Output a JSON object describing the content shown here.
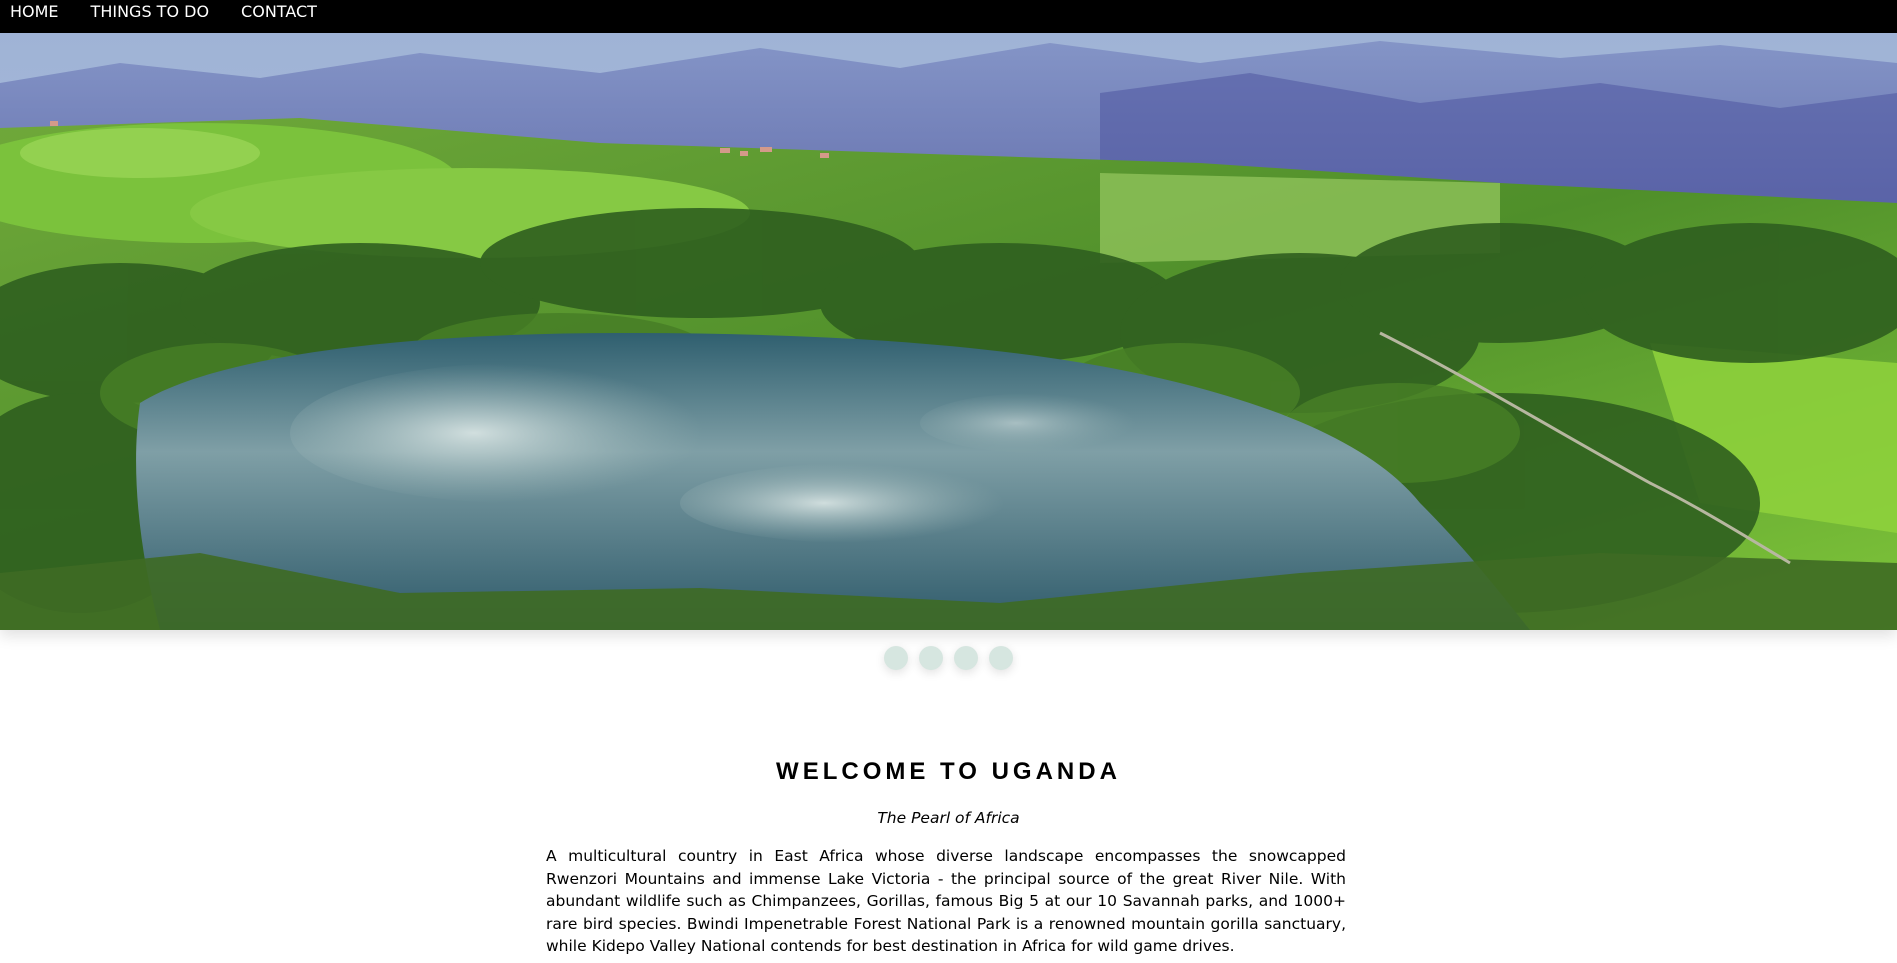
{
  "nav": {
    "items": [
      {
        "label": "HOME"
      },
      {
        "label": "THINGS TO DO"
      },
      {
        "label": "CONTACT"
      }
    ]
  },
  "hero": {
    "image": "uganda-crater-lake-landscape",
    "slides": 4,
    "active_slide": 1
  },
  "content": {
    "heading": "WELCOME TO UGANDA",
    "tagline": "The Pearl of Africa",
    "intro": "A multicultural country in East Africa whose diverse landscape encompasses the snowcapped Rwenzori Mountains and immense Lake Victoria - the principal source of the great River Nile. With abundant wildlife such as Chimpanzees, Gorillas, famous Big 5 at our 10 Savannah parks, and 1000+ rare bird species. Bwindi Impenetrable Forest National Park is a renowned mountain gorilla sanctuary, while Kidepo Valley National contends for best destination in Africa for wild game drives."
  },
  "colors": {
    "nav_bg": "#000000",
    "nav_text": "#ffffff",
    "dot": "#d6e6e0"
  }
}
